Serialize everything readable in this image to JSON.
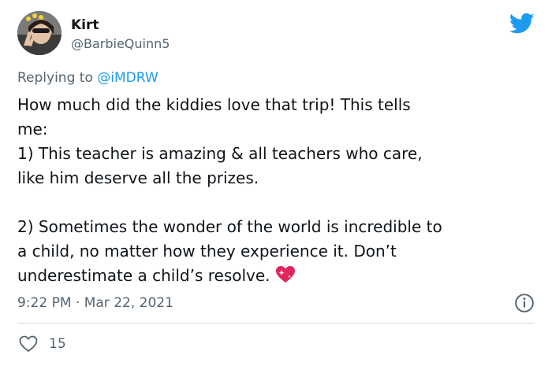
{
  "tweet": {
    "display_name": "Kirt",
    "handle": "@BarbieQuinn5",
    "replying_prefix": "Replying to ",
    "replying_to": "@iMDRW",
    "body": "How much did the kiddies love that trip! This tells\nme:\n1) This teacher is amazing & all teachers who care,\nlike him deserve all the prizes.\n\n2) Sometimes the wonder of the world is incredible to\na child, no matter how they experience it. Don’t\nunderestimate a child’s resolve.",
    "emoji": "sparkling-heart",
    "timestamp": "9:22 PM · Mar 22, 2021",
    "like_count": "15"
  },
  "icons": {
    "brand": "twitter-bird-icon",
    "info": "info-icon",
    "like": "heart-outline-icon"
  },
  "colors": {
    "brand_blue": "#1d9bf0",
    "secondary_text": "#536471",
    "primary_text": "#0f1419",
    "divider": "#cfd9de",
    "emoji_pink": "#e0245e"
  }
}
